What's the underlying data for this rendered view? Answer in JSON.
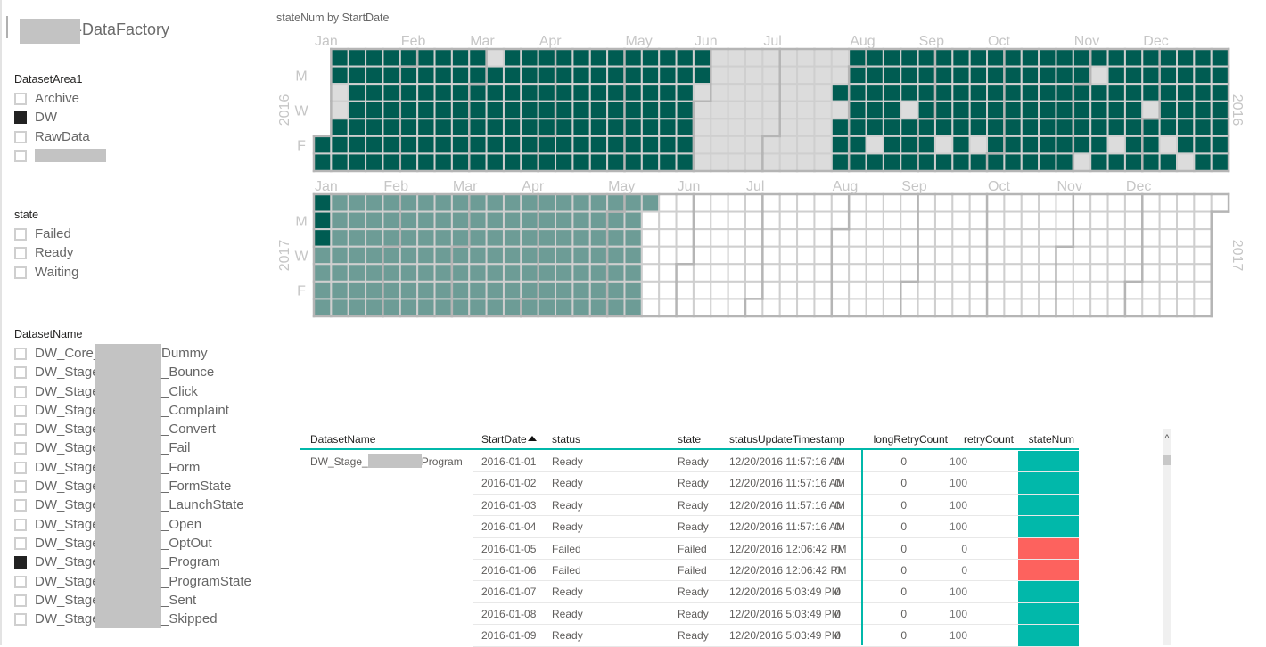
{
  "report": {
    "title_suffix": "-DataFactory"
  },
  "slicers": {
    "dataset_area": {
      "title": "DatasetArea1",
      "items": [
        {
          "label": "Archive",
          "checked": false
        },
        {
          "label": "DW",
          "checked": true
        },
        {
          "label": "RawData",
          "checked": false
        },
        {
          "label": "",
          "redacted": true,
          "checked": false
        }
      ]
    },
    "state": {
      "title": "state",
      "items": [
        {
          "label": "Failed",
          "checked": false
        },
        {
          "label": "Ready",
          "checked": false
        },
        {
          "label": "Waiting",
          "checked": false
        }
      ]
    },
    "dataset_name": {
      "title": "DatasetName",
      "items": [
        {
          "prefix": "DW_Core_",
          "suffix": "Dummy",
          "checked": false
        },
        {
          "prefix": "DW_Stage_",
          "suffix": "_Bounce",
          "checked": false
        },
        {
          "prefix": "DW_Stage_",
          "suffix": "_Click",
          "checked": false
        },
        {
          "prefix": "DW_Stage_",
          "suffix": "_Complaint",
          "checked": false
        },
        {
          "prefix": "DW_Stage_",
          "suffix": "_Convert",
          "checked": false
        },
        {
          "prefix": "DW_Stage_",
          "suffix": "_Fail",
          "checked": false
        },
        {
          "prefix": "DW_Stage_",
          "suffix": "_Form",
          "checked": false
        },
        {
          "prefix": "DW_Stage_",
          "suffix": "_FormState",
          "checked": false
        },
        {
          "prefix": "DW_Stage_",
          "suffix": "_LaunchState",
          "checked": false
        },
        {
          "prefix": "DW_Stage_",
          "suffix": "_Open",
          "checked": false
        },
        {
          "prefix": "DW_Stage_",
          "suffix": "_OptOut",
          "checked": false
        },
        {
          "prefix": "DW_Stage_",
          "suffix": "_Program",
          "checked": true
        },
        {
          "prefix": "DW_Stage_",
          "suffix": "_ProgramState",
          "checked": false
        },
        {
          "prefix": "DW_Stage_",
          "suffix": "_Sent",
          "checked": false
        },
        {
          "prefix": "DW_Stage_",
          "suffix": "_Skipped",
          "checked": false
        }
      ]
    }
  },
  "chart_data": {
    "type": "heatmap",
    "subtype": "calendar",
    "title": "stateNum by StartDate",
    "value_field": "stateNum",
    "date_field": "StartDate",
    "weekday_labels": [
      "",
      "M",
      "",
      "W",
      "",
      "F",
      ""
    ],
    "month_labels": [
      "Jan",
      "Feb",
      "Mar",
      "Apr",
      "May",
      "Jun",
      "Jul",
      "Aug",
      "Sep",
      "Oct",
      "Nov",
      "Dec"
    ],
    "color_scale": {
      "100": "#005c52",
      "50": "#6d9c96",
      "0": "#dcdcdc",
      "empty": "#ffffff"
    },
    "legend": "none",
    "years": [
      {
        "year": 2016,
        "segments": [
          {
            "from": "2016-01-01",
            "to": "2016-12-31",
            "value": 100
          }
        ],
        "overrides": [
          {
            "from": "2016-01-05",
            "to": "2016-01-06",
            "value": 0
          },
          {
            "from": "2016-03-06",
            "to": "2016-03-06",
            "value": 0
          },
          {
            "from": "2016-05-31",
            "to": "2016-07-25",
            "value": 0
          },
          {
            "from": "2016-07-27",
            "to": "2016-07-27",
            "value": 0
          },
          {
            "from": "2016-08-12",
            "to": "2016-08-12",
            "value": 0
          },
          {
            "from": "2016-08-24",
            "to": "2016-08-24",
            "value": 0
          },
          {
            "from": "2016-09-09",
            "to": "2016-09-09",
            "value": 0
          },
          {
            "from": "2016-09-23",
            "to": "2016-09-23",
            "value": 0
          },
          {
            "from": "2016-11-05",
            "to": "2016-11-05",
            "value": 0
          },
          {
            "from": "2016-11-07",
            "to": "2016-11-07",
            "value": 0
          },
          {
            "from": "2016-11-18",
            "to": "2016-11-18",
            "value": 0
          },
          {
            "from": "2016-11-30",
            "to": "2016-11-30",
            "value": 0
          },
          {
            "from": "2016-12-09",
            "to": "2016-12-09",
            "value": 0
          },
          {
            "from": "2016-12-17",
            "to": "2016-12-17",
            "value": 0
          }
        ]
      },
      {
        "year": 2017,
        "segments": [
          {
            "from": "2017-01-01",
            "to": "2017-01-03",
            "value": 100
          },
          {
            "from": "2017-01-04",
            "to": "2017-05-14",
            "value": 50
          }
        ],
        "overrides": []
      }
    ]
  },
  "table": {
    "columns": [
      "DatasetName",
      "StartDate",
      "status",
      "state",
      "statusUpdateTimestamp",
      "longRetryCount",
      "retryCount",
      "stateNum"
    ],
    "sort": {
      "column": "StartDate",
      "direction": "ascending"
    },
    "group": {
      "dataset_prefix": "DW_Stage_",
      "dataset_suffix": "Program"
    },
    "rows": [
      {
        "start_date": "2016-01-01",
        "status": "Ready",
        "state": "Ready",
        "status_update_timestamp": "12/20/2016 11:57:16 AM",
        "long_retry_count": "0",
        "retry_count": "0",
        "state_num": "100"
      },
      {
        "start_date": "2016-01-02",
        "status": "Ready",
        "state": "Ready",
        "status_update_timestamp": "12/20/2016 11:57:16 AM",
        "long_retry_count": "0",
        "retry_count": "0",
        "state_num": "100"
      },
      {
        "start_date": "2016-01-03",
        "status": "Ready",
        "state": "Ready",
        "status_update_timestamp": "12/20/2016 11:57:16 AM",
        "long_retry_count": "0",
        "retry_count": "0",
        "state_num": "100"
      },
      {
        "start_date": "2016-01-04",
        "status": "Ready",
        "state": "Ready",
        "status_update_timestamp": "12/20/2016 11:57:16 AM",
        "long_retry_count": "0",
        "retry_count": "0",
        "state_num": "100"
      },
      {
        "start_date": "2016-01-05",
        "status": "Failed",
        "state": "Failed",
        "status_update_timestamp": "12/20/2016 12:06:42 PM",
        "long_retry_count": "0",
        "retry_count": "0",
        "state_num": "0"
      },
      {
        "start_date": "2016-01-06",
        "status": "Failed",
        "state": "Failed",
        "status_update_timestamp": "12/20/2016 12:06:42 PM",
        "long_retry_count": "0",
        "retry_count": "0",
        "state_num": "0"
      },
      {
        "start_date": "2016-01-07",
        "status": "Ready",
        "state": "Ready",
        "status_update_timestamp": "12/20/2016 5:03:49 PM",
        "long_retry_count": "0",
        "retry_count": "0",
        "state_num": "100"
      },
      {
        "start_date": "2016-01-08",
        "status": "Ready",
        "state": "Ready",
        "status_update_timestamp": "12/20/2016 5:03:49 PM",
        "long_retry_count": "0",
        "retry_count": "0",
        "state_num": "100"
      },
      {
        "start_date": "2016-01-09",
        "status": "Ready",
        "state": "Ready",
        "status_update_timestamp": "12/20/2016 5:03:49 PM",
        "long_retry_count": "0",
        "retry_count": "0",
        "state_num": "100"
      }
    ],
    "scroll_up_glyph": "^"
  },
  "colors": {
    "accent": "#01b8aa",
    "ready": "#01b8aa",
    "failed": "#fd625e"
  }
}
